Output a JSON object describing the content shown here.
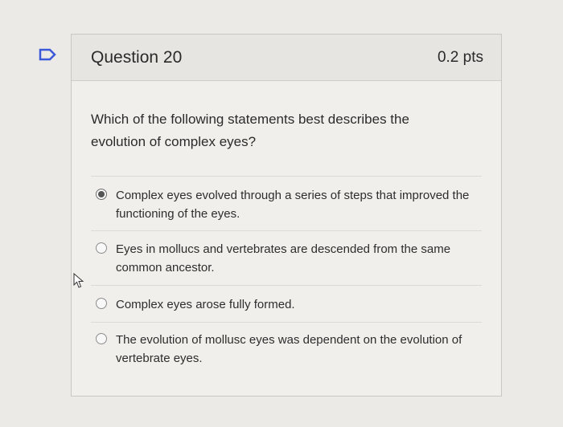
{
  "question": {
    "title": "Question 20",
    "points": "0.2 pts",
    "text": "Which of the following statements best describes the evolution of complex eyes?"
  },
  "options": [
    {
      "label": "Complex eyes evolved through a series of steps that improved the functioning of the eyes.",
      "selected": true
    },
    {
      "label": "Eyes in mollucs and vertebrates are descended from the same common ancestor.",
      "selected": false
    },
    {
      "label": "Complex eyes arose fully formed.",
      "selected": false
    },
    {
      "label": "The evolution of mollusc eyes was dependent on the evolution of vertebrate eyes.",
      "selected": false
    }
  ],
  "icons": {
    "bookmark": "bookmark-flag-icon",
    "cursor": "mouse-pointer-icon"
  },
  "colors": {
    "bookmark_stroke": "#3b59d9"
  }
}
